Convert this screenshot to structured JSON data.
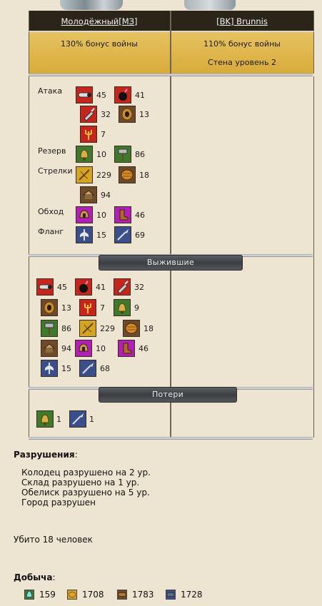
{
  "header": {
    "attacker": "Молодёжный[МЗ]",
    "defender": "[BK] Brunnis"
  },
  "bonus": {
    "attacker": "130% бонус войны",
    "defender": "110% бонус войны",
    "defender_wall": "Стена уровень 2"
  },
  "groups": [
    {
      "label": "Атака"
    },
    {
      "label": "Резерв"
    },
    {
      "label": "Стрелки"
    },
    {
      "label": "Обход"
    },
    {
      "label": "Фланг"
    }
  ],
  "army": [
    {
      "icon": "cannon-icon",
      "count": "45"
    },
    {
      "icon": "bomb-icon",
      "count": "41"
    },
    {
      "icon": "drill-icon",
      "count": "32"
    },
    {
      "icon": "horn-icon",
      "count": "13"
    },
    {
      "icon": "trident-icon",
      "count": "7"
    },
    {
      "icon": "bell-icon",
      "count": "10"
    },
    {
      "icon": "hammer-icon",
      "count": "86"
    },
    {
      "icon": "crossbow-icon",
      "count": "229"
    },
    {
      "icon": "shield-icon",
      "count": "18"
    },
    {
      "icon": "cart-icon",
      "count": "94"
    },
    {
      "icon": "helmet-icon",
      "count": "10"
    },
    {
      "icon": "boot-icon",
      "count": "46"
    },
    {
      "icon": "axe-icon",
      "count": "15"
    },
    {
      "icon": "spear-icon",
      "count": "69"
    }
  ],
  "survivors_title": "Выжившие",
  "survivors": [
    {
      "icon": "cannon-icon",
      "count": "45"
    },
    {
      "icon": "bomb-icon",
      "count": "41"
    },
    {
      "icon": "drill-icon",
      "count": "32"
    },
    {
      "icon": "horn-icon",
      "count": "13"
    },
    {
      "icon": "trident-icon",
      "count": "7"
    },
    {
      "icon": "bell-icon",
      "count": "9"
    },
    {
      "icon": "hammer-icon",
      "count": "86"
    },
    {
      "icon": "crossbow-icon",
      "count": "229"
    },
    {
      "icon": "shield-icon",
      "count": "18"
    },
    {
      "icon": "cart-icon",
      "count": "94"
    },
    {
      "icon": "helmet-icon",
      "count": "10"
    },
    {
      "icon": "boot-icon",
      "count": "46"
    },
    {
      "icon": "axe-icon",
      "count": "15"
    },
    {
      "icon": "spear-icon",
      "count": "68"
    }
  ],
  "losses_title": "Потери",
  "losses": [
    {
      "icon": "bell-icon",
      "count": "1"
    },
    {
      "icon": "spear-icon",
      "count": "1"
    }
  ],
  "destruction": {
    "title": "Разрушения",
    "colon": ":",
    "lines": [
      "Колодец разрушено на 2 ур.",
      "Склад разрушено на 1 ур.",
      "Обелиск разрушено на 5 ур.",
      "Город разрушен"
    ]
  },
  "killed": "Убито 18 человек",
  "loot": {
    "title": "Добыча",
    "colon": ":",
    "items": [
      {
        "icon": "flask-icon",
        "value": "159"
      },
      {
        "icon": "grain-icon",
        "value": "1708"
      },
      {
        "icon": "wood-icon",
        "value": "1783"
      },
      {
        "icon": "iron-icon",
        "value": "1728"
      }
    ]
  },
  "colors": {
    "header_bg": "#2b2519",
    "gold": "#d8ab3a",
    "banner": "#45484b"
  }
}
